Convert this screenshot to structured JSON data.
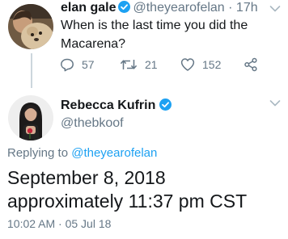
{
  "colors": {
    "accent": "#1da1f2",
    "text": "#14171a",
    "muted": "#657786",
    "line": "#ccd6dd"
  },
  "original_tweet": {
    "author_name": "elan gale",
    "handle": "@theyearofelan",
    "separator": "·",
    "time_ago": "17h",
    "text": "When is the last time you did the Macarena?",
    "replies": "57",
    "retweets": "21",
    "likes": "152",
    "icons": [
      "reply-icon",
      "retweet-icon",
      "like-icon",
      "share-icon",
      "verified-badge-icon",
      "chevron-down-icon"
    ]
  },
  "reply_tweet": {
    "author_name": "Rebecca Kufrin",
    "handle": "@thebkoof",
    "replying_prefix": "Replying to",
    "replying_to": "@theyearofelan",
    "text": "September 8, 2018 approximately 11:37 pm CST",
    "timestamp": "10:02 AM · 05 Jul 18",
    "icons": [
      "verified-badge-icon",
      "chevron-down-icon"
    ]
  }
}
